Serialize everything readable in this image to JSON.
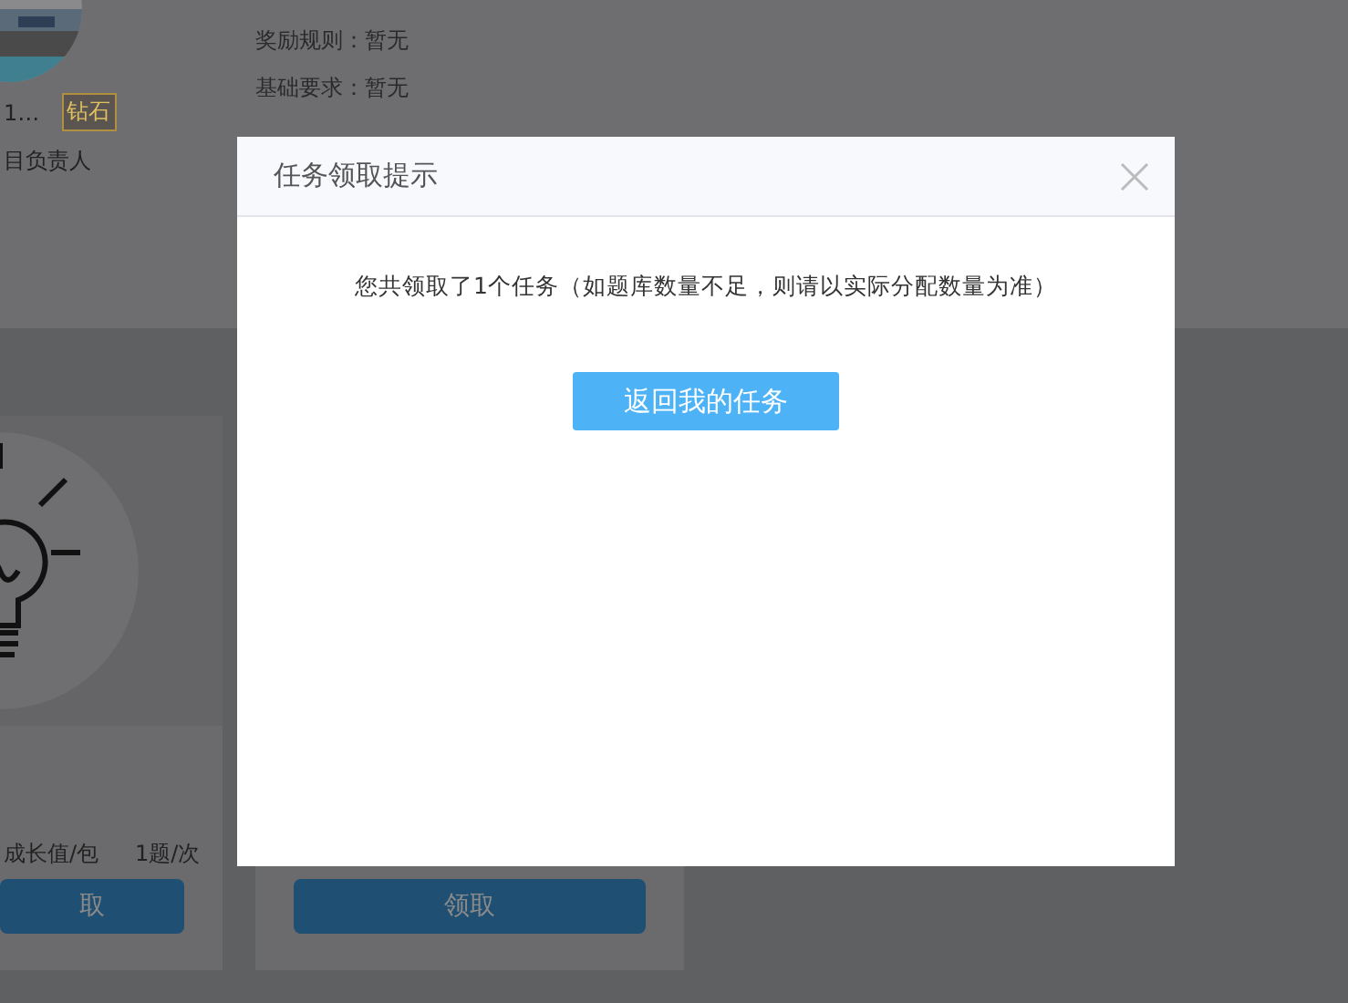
{
  "profile": {
    "name": "1…",
    "badge": "钻石",
    "role": "目负责人"
  },
  "details": [
    "奖励规则：暂无",
    "基础要求：暂无"
  ],
  "cards": [
    {
      "kind": "bulb",
      "stats": [
        "成长值/包",
        "1题/次"
      ],
      "button": "取"
    },
    {
      "kind": "plain",
      "button": "领取"
    }
  ],
  "dialog": {
    "title": "任务领取提示",
    "message": "您共领取了1个任务（如题库数量不足，则请以实际分配数量为准）",
    "button": "返回我的任务"
  }
}
